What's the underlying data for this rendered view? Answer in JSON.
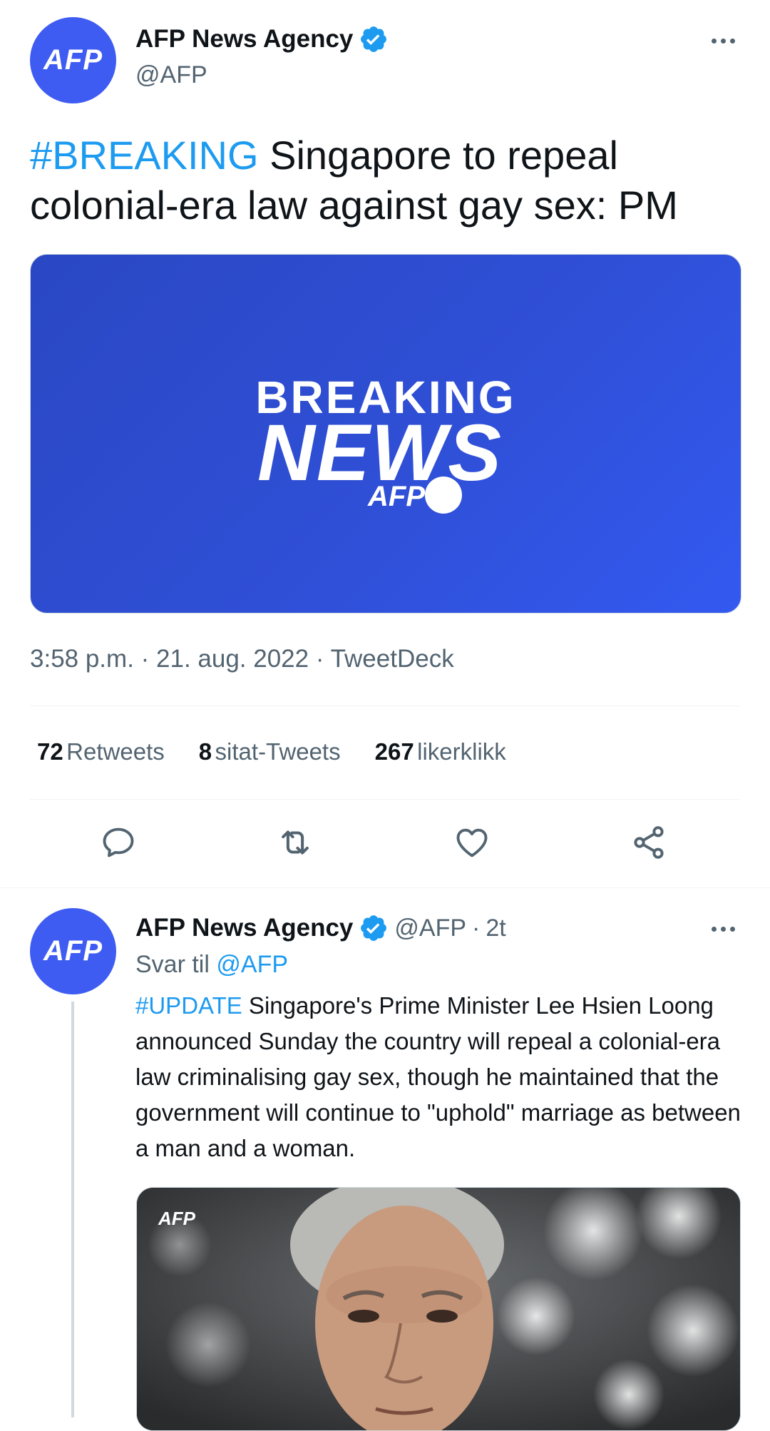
{
  "main_tweet": {
    "avatar_text": "AFP",
    "author_name": "AFP News Agency",
    "author_handle": "@AFP",
    "hashtag": "#BREAKING",
    "text": " Singapore to repeal colonial-era law against gay sex: PM",
    "media": {
      "line1": "BREAKING",
      "line2": "NEWS",
      "brand": "AFP"
    },
    "timestamp": "3:58 p.m. · 21. aug. 2022 · TweetDeck",
    "stats": {
      "retweets_count": "72",
      "retweets_label": "Retweets",
      "quotes_count": "8",
      "quotes_label": "sitat-Tweets",
      "likes_count": "267",
      "likes_label": "likerklikk"
    }
  },
  "reply_tweet": {
    "avatar_text": "AFP",
    "author_name": "AFP News Agency",
    "author_handle": "@AFP",
    "separator": "·",
    "time_ago": "2t",
    "reply_to_label": "Svar til",
    "reply_to_handle": "@AFP",
    "hashtag": "#UPDATE",
    "text": " Singapore's Prime Minister Lee Hsien Loong announced Sunday the country will repeal a colonial-era law criminalising gay sex, though he maintained that the government will continue to \"uphold\" marriage as between a man and a woman.",
    "photo_watermark": "AFP"
  },
  "icons": [
    "verified-badge-icon",
    "more-icon",
    "reply-icon",
    "retweet-icon",
    "like-icon",
    "share-icon"
  ],
  "colors": {
    "accent": "#1d9bf0",
    "afp_blue": "#3f5cf2",
    "muted": "#536471"
  }
}
